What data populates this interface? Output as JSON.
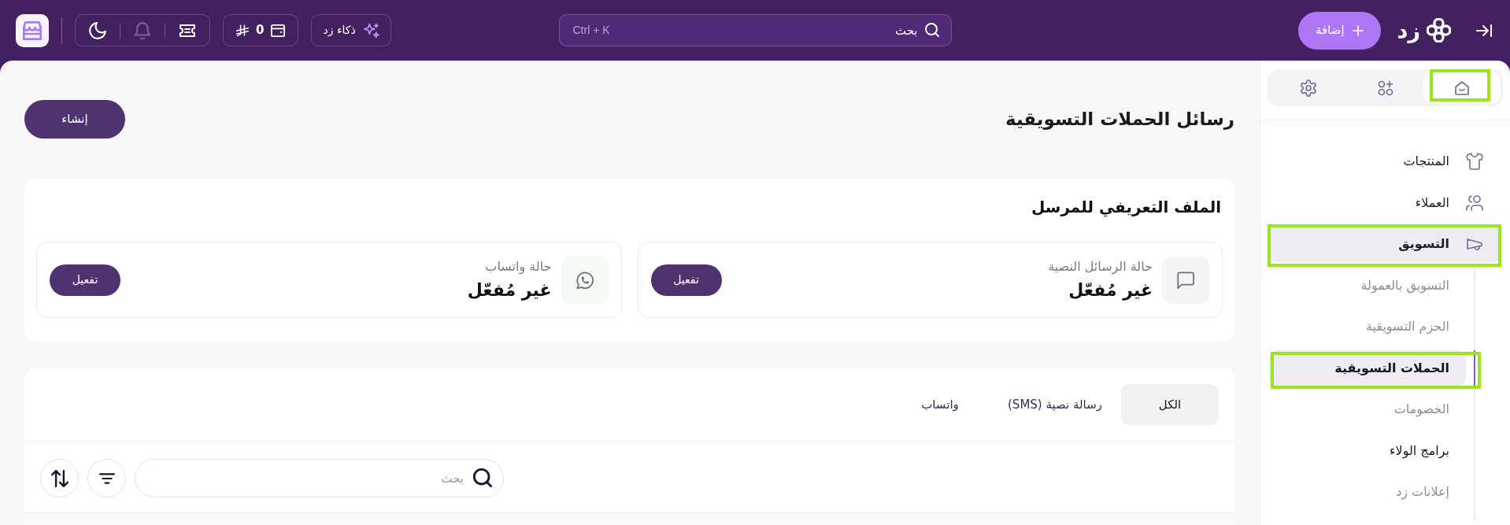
{
  "top_bar": {
    "brand": {
      "name": "زد"
    },
    "add_button": {
      "label": "إضافة"
    },
    "search": {
      "placeholder": "بحث",
      "shortcut": "Ctrl + K"
    },
    "ai_button": {
      "label": "ذكاء زد"
    },
    "wallet": {
      "balance": "0"
    },
    "notifications": {
      "disabled": true
    }
  },
  "sidebar": {
    "tabs": [
      {
        "kind": "home",
        "selected": true,
        "highlighted": true
      },
      {
        "kind": "apps",
        "selected": false,
        "highlighted": false
      },
      {
        "kind": "settings",
        "selected": false,
        "highlighted": false
      }
    ],
    "items": [
      {
        "kind": "products",
        "label": "المنتجات",
        "selected": false,
        "highlighted": false
      },
      {
        "kind": "customers",
        "label": "العملاء",
        "selected": false,
        "highlighted": false
      },
      {
        "kind": "marketing",
        "label": "التسويق",
        "selected": true,
        "highlighted": true,
        "children": [
          {
            "label": "التسويق بالعمولة",
            "selected": false,
            "dimmed": true,
            "highlighted": false
          },
          {
            "label": "الحزم التسويقية",
            "selected": false,
            "dimmed": true,
            "highlighted": false
          },
          {
            "label": "الحملات التسويقية",
            "selected": true,
            "dimmed": false,
            "highlighted": true
          },
          {
            "label": "الخصومات",
            "selected": false,
            "dimmed": true,
            "highlighted": false
          },
          {
            "label": "برامج الولاء",
            "selected": false,
            "dimmed": false,
            "highlighted": false
          },
          {
            "label": "إعلانات زد",
            "selected": false,
            "dimmed": true,
            "highlighted": false
          }
        ]
      }
    ]
  },
  "page": {
    "title": "رسائل الحملات التسويقية",
    "create_button": {
      "label": "إنشاء"
    }
  },
  "sender_profile": {
    "title": "الملف التعريفي للمرسل",
    "channels": [
      {
        "kind": "sms",
        "label": "حالة الرسائل النصية",
        "status": "غير مُفعّل",
        "button": {
          "label": "تفعيل"
        }
      },
      {
        "kind": "whatsapp",
        "label": "حالة واتساب",
        "status": "غير مُفعّل",
        "button": {
          "label": "تفعيل"
        }
      }
    ]
  },
  "campaigns": {
    "tabs": [
      {
        "label": "الكل",
        "selected": true
      },
      {
        "label": "رسالة نصية (SMS)",
        "selected": false
      },
      {
        "label": "واتساب",
        "selected": false
      }
    ],
    "search": {
      "placeholder": "بحث"
    }
  }
}
